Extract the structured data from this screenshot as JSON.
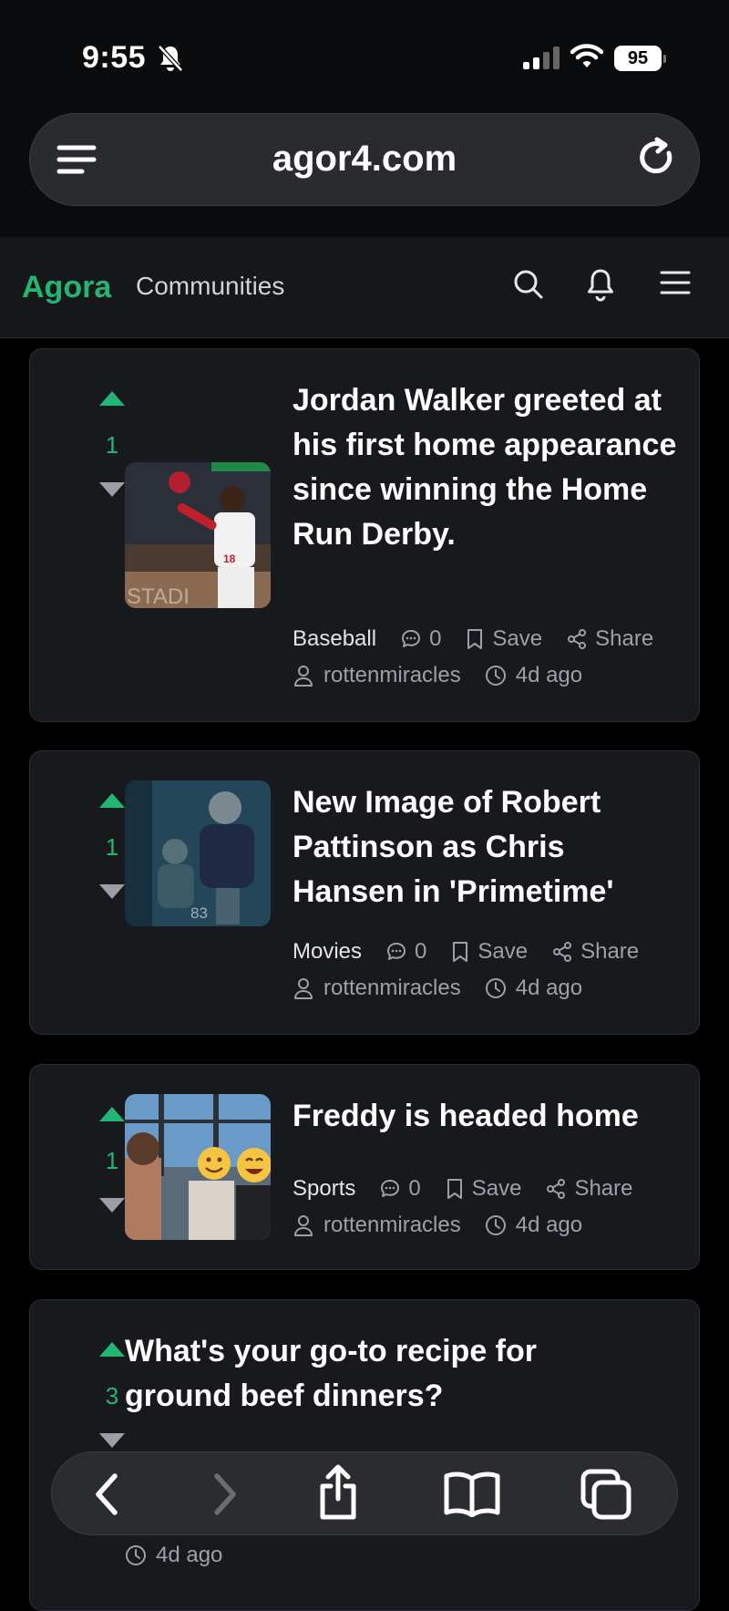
{
  "status_bar": {
    "time": "9:55",
    "battery": "95"
  },
  "browser": {
    "url": "agor4.com"
  },
  "site_header": {
    "brand": "Agora",
    "communities_label": "Communities"
  },
  "posts": [
    {
      "votes": "1",
      "title": "Jordan Walker greeted at his first home appearance since winning the Home Run Derby.",
      "category": "Baseball",
      "comments": "0",
      "save": "Save",
      "share": "Share",
      "author": "rottenmiracles",
      "age": "4d ago",
      "thumbnail": "baseball-player-photo"
    },
    {
      "votes": "1",
      "title": "New Image of Robert Pattinson as Chris Hansen in 'Primetime'",
      "category": "Movies",
      "comments": "0",
      "save": "Save",
      "share": "Share",
      "author": "rottenmiracles",
      "age": "4d ago",
      "thumbnail": "movie-still-photo",
      "thumbnail_text": "83"
    },
    {
      "votes": "1",
      "title": "Freddy is headed home",
      "category": "Sports",
      "comments": "0",
      "save": "Save",
      "share": "Share",
      "author": "rottenmiracles",
      "age": "4d ago",
      "thumbnail": "group-photo-emoji-faces"
    },
    {
      "votes": "3",
      "title": "What's your go-to recipe for ground beef dinners?",
      "age": "4d ago"
    }
  ],
  "colors": {
    "accent": "#22b573",
    "card_bg": "#18191c",
    "page_bg": "#000000"
  },
  "icons": [
    "bell-off-icon",
    "wifi-icon",
    "menu-icon",
    "reload-icon",
    "search-icon",
    "bell-icon",
    "hamburger-icon",
    "comment-icon",
    "bookmark-icon",
    "share-icon",
    "user-icon",
    "clock-icon",
    "back-icon",
    "forward-icon",
    "share-sheet-icon",
    "bookmarks-icon",
    "tabs-icon"
  ]
}
